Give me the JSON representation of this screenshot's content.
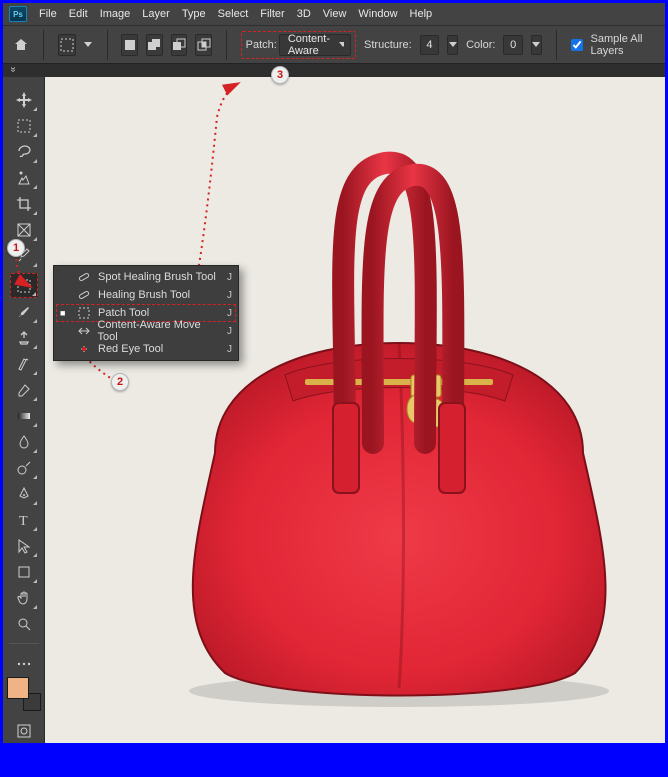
{
  "menubar": {
    "badge": "Ps",
    "items": [
      "File",
      "Edit",
      "Image",
      "Layer",
      "Type",
      "Select",
      "Filter",
      "3D",
      "View",
      "Window",
      "Help"
    ]
  },
  "options": {
    "patch_label": "Patch:",
    "patch_value": "Content-Aware",
    "structure_label": "Structure:",
    "structure_value": "4",
    "color_label": "Color:",
    "color_value": "0",
    "sample_all_label": "Sample All Layers",
    "sample_all_checked": true
  },
  "flyout": {
    "items": [
      {
        "label": "Spot Healing Brush Tool",
        "shortcut": "J",
        "checked": false
      },
      {
        "label": "Healing Brush Tool",
        "shortcut": "J",
        "checked": false
      },
      {
        "label": "Patch Tool",
        "shortcut": "J",
        "checked": true,
        "selected": true
      },
      {
        "label": "Content-Aware Move Tool",
        "shortcut": "J",
        "checked": false
      },
      {
        "label": "Red Eye Tool",
        "shortcut": "J",
        "checked": false
      }
    ]
  },
  "callouts": {
    "c1": "1",
    "c2": "2",
    "c3": "3"
  },
  "colors": {
    "accent": "#d62222",
    "bag_red": "#e12636",
    "bag_red_dark": "#a5121f"
  }
}
